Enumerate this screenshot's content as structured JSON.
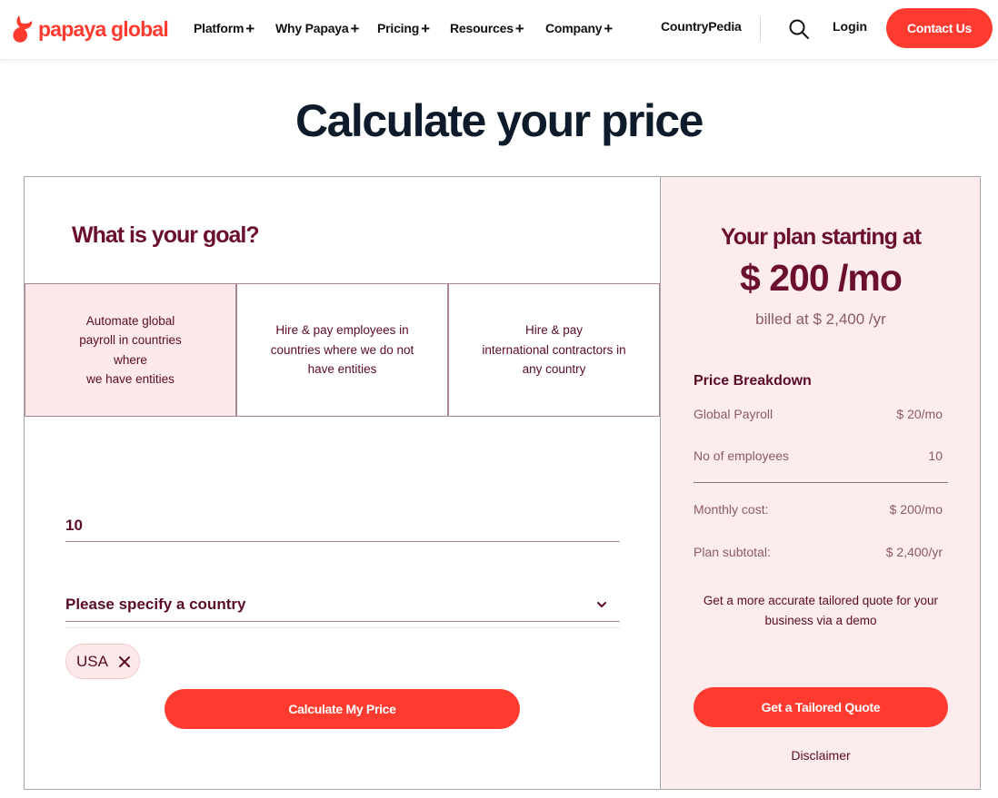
{
  "header": {
    "logo_text": "papaya global",
    "nav": [
      {
        "label": "Platform",
        "has_plus": true
      },
      {
        "label": "Why Papaya",
        "has_plus": true
      },
      {
        "label": "Pricing",
        "has_plus": true
      },
      {
        "label": "Resources",
        "has_plus": true
      },
      {
        "label": "Company",
        "has_plus": true
      }
    ],
    "countrypedia": "CountryPedia",
    "login": "Login",
    "contact": "Contact Us",
    "search_icon": "search-icon"
  },
  "page": {
    "title": "Calculate your price"
  },
  "calculator": {
    "goal_title": "What is your goal?",
    "goals": [
      {
        "lines": [
          "Automate global",
          "payroll in countries",
          "where",
          "we have entities"
        ],
        "active": true
      },
      {
        "lines": [
          "Hire & pay employees in",
          "countries where we do not",
          "have entities"
        ],
        "active": false
      },
      {
        "lines": [
          "Hire & pay",
          "international contractors in",
          "any country"
        ],
        "active": false
      }
    ],
    "employees_value": "10",
    "country_placeholder": "Please specify a country",
    "selected_country": "USA",
    "calculate_button": "Calculate My Price"
  },
  "plan": {
    "title": "Your plan starting at",
    "price": "$ 200 /mo",
    "billed": "billed at $ 2,400 /yr",
    "breakdown_title": "Price Breakdown",
    "breakdown": {
      "global_payroll_label": "Global Payroll",
      "global_payroll_value": "$ 20/mo",
      "employees_label": "No of employees",
      "employees_value": "10",
      "monthly_label": "Monthly cost:",
      "monthly_value": "$ 200/mo",
      "subtotal_label": "Plan subtotal:",
      "subtotal_value": "$ 2,400/yr"
    },
    "demo_note_line1": "Get a more accurate tailored quote for your",
    "demo_note_line2": "business via a demo",
    "quote_button": "Get a Tailored Quote",
    "disclaimer": "Disclaimer"
  },
  "colors": {
    "brand": "#ff3b30",
    "heading": "#6a0f2e",
    "panel_bg": "#fdeced"
  }
}
